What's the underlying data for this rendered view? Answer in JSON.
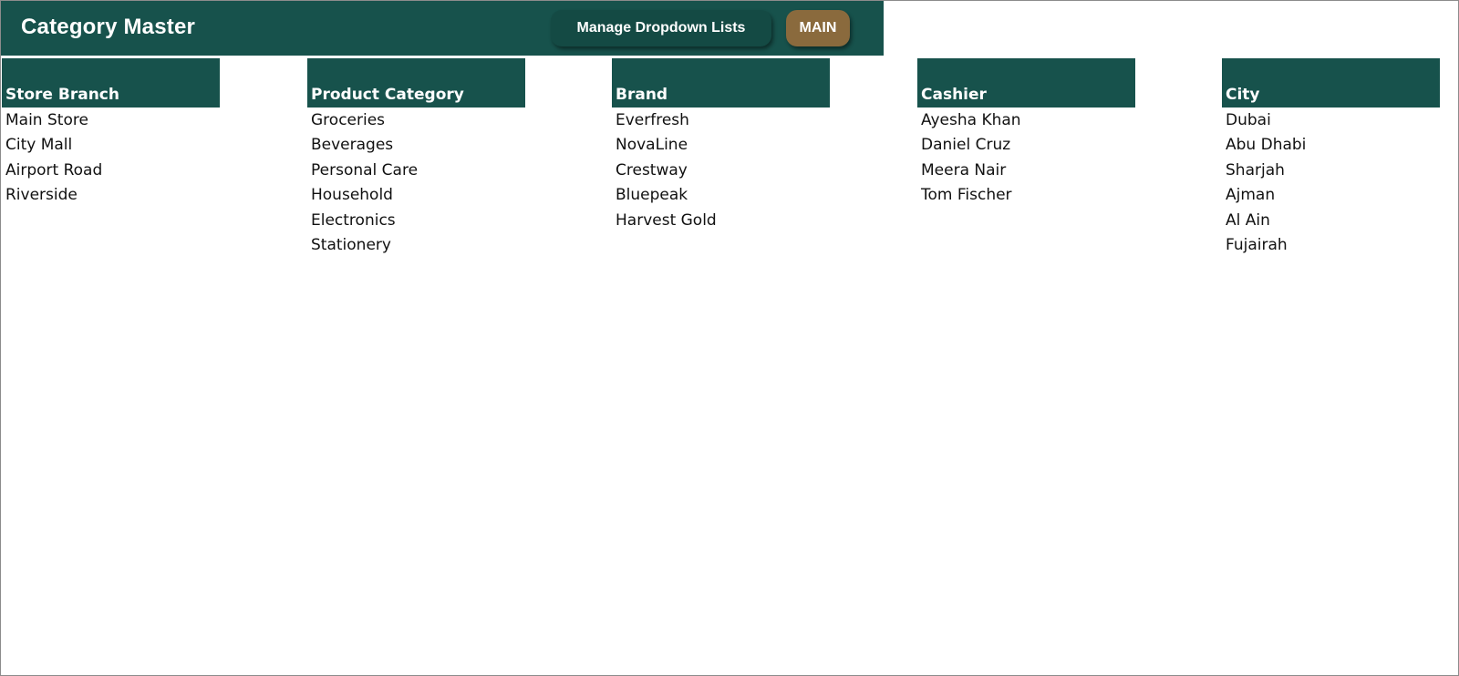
{
  "header": {
    "title": "Category Master",
    "manage_button_label": "Manage Dropdown Lists",
    "main_button_label": "MAIN"
  },
  "colors": {
    "header_green": "#17524c",
    "main_button_brown": "#8a6a3d"
  },
  "columns": [
    {
      "header": "Store Branch",
      "items": [
        "Main Store",
        "City Mall",
        "Airport Road",
        "Riverside"
      ]
    },
    {
      "header": "Product Category",
      "items": [
        "Groceries",
        "Beverages",
        "Personal Care",
        "Household",
        "Electronics",
        "Stationery"
      ]
    },
    {
      "header": "Brand",
      "items": [
        "Everfresh",
        "NovaLine",
        "Crestway",
        "Bluepeak",
        "Harvest Gold"
      ]
    },
    {
      "header": "Cashier",
      "items": [
        "Ayesha Khan",
        "Daniel Cruz",
        "Meera Nair",
        "Tom Fischer"
      ]
    },
    {
      "header": "City",
      "items": [
        "Dubai",
        "Abu Dhabi",
        "Sharjah",
        "Ajman",
        "Al Ain",
        "Fujairah"
      ]
    }
  ]
}
